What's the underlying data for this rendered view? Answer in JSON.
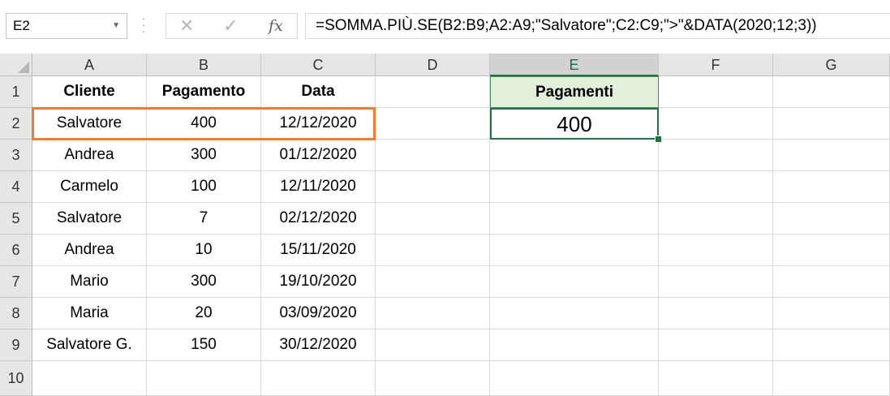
{
  "formula_bar": {
    "name_box": "E2",
    "cancel_glyph": "✕",
    "enter_glyph": "✓",
    "fx_label": "fx",
    "formula": "=SOMMA.PIÙ.SE(B2:B9;A2:A9;\"Salvatore\";C2:C9;\">\"&DATA(2020;12;3))"
  },
  "columns": [
    "A",
    "B",
    "C",
    "D",
    "E",
    "F",
    "G"
  ],
  "rows": [
    "1",
    "2",
    "3",
    "4",
    "5",
    "6",
    "7",
    "8",
    "9",
    "10"
  ],
  "table": {
    "headers": [
      "Cliente",
      "Pagamento",
      "Data"
    ],
    "rows": [
      [
        "Salvatore",
        "400",
        "12/12/2020"
      ],
      [
        "Andrea",
        "300",
        "01/12/2020"
      ],
      [
        "Carmelo",
        "100",
        "12/11/2020"
      ],
      [
        "Salvatore",
        "7",
        "02/12/2020"
      ],
      [
        "Andrea",
        "10",
        "15/11/2020"
      ],
      [
        "Mario",
        "300",
        "19/10/2020"
      ],
      [
        "Maria",
        "20",
        "03/09/2020"
      ],
      [
        "Salvatore G.",
        "150",
        "30/12/2020"
      ]
    ]
  },
  "result": {
    "header": "Pagamenti",
    "value": "400"
  },
  "colors": {
    "accent": "#217346",
    "highlight": "#ed7d31",
    "result_header_fill": "#e2efda"
  }
}
